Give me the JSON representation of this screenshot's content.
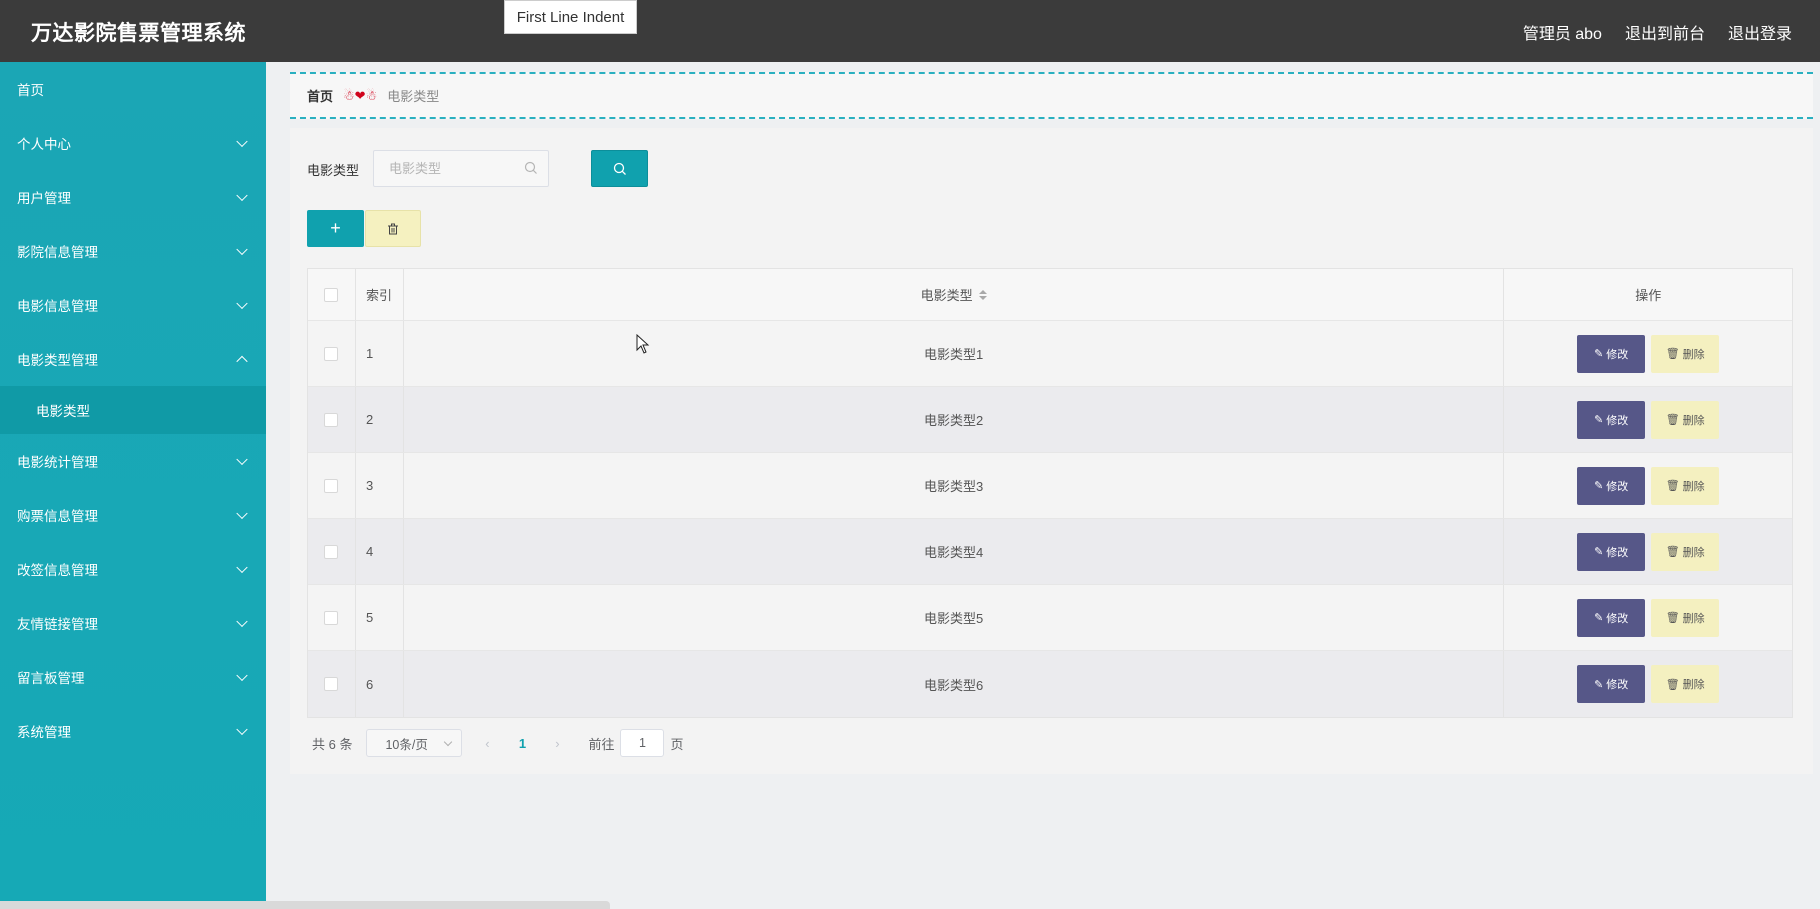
{
  "header": {
    "title": "万达影院售票管理系统",
    "tooltip": "First Line Indent",
    "links": [
      "管理员 abo",
      "退出到前台",
      "退出登录"
    ]
  },
  "sidebar": {
    "items": [
      {
        "label": "首页"
      },
      {
        "label": "个人中心"
      },
      {
        "label": "用户管理"
      },
      {
        "label": "影院信息管理"
      },
      {
        "label": "电影信息管理"
      },
      {
        "label": "电影类型管理"
      },
      {
        "label": "电影统计管理"
      },
      {
        "label": "购票信息管理"
      },
      {
        "label": "改签信息管理"
      },
      {
        "label": "友情链接管理"
      },
      {
        "label": "留言板管理"
      },
      {
        "label": "系统管理"
      }
    ],
    "sub_item": "电影类型"
  },
  "breadcrumb": {
    "home": "首页",
    "separator": "☃❤☃",
    "current": "电影类型"
  },
  "search": {
    "label": "电影类型",
    "placeholder": "电影类型",
    "value": ""
  },
  "toolbar": {
    "add_symbol": "+"
  },
  "table": {
    "headers": {
      "index": "索引",
      "type": "电影类型",
      "ops": "操作"
    },
    "edit_label": "修改",
    "delete_label": "删除",
    "rows": [
      {
        "index": "1",
        "type": "电影类型1"
      },
      {
        "index": "2",
        "type": "电影类型2"
      },
      {
        "index": "3",
        "type": "电影类型3"
      },
      {
        "index": "4",
        "type": "电影类型4"
      },
      {
        "index": "5",
        "type": "电影类型5"
      },
      {
        "index": "6",
        "type": "电影类型6"
      }
    ]
  },
  "pagination": {
    "total": "共 6 条",
    "page_size": "10条/页",
    "current_page": "1",
    "goto_label": "前往",
    "goto_value": "1",
    "page_suffix": "页"
  },
  "colors": {
    "sidebar": "#16a9b6",
    "topbar": "#3b3b3b",
    "primary": "#10a1ae",
    "edit": "#565788",
    "delete": "#f4f0c0"
  }
}
